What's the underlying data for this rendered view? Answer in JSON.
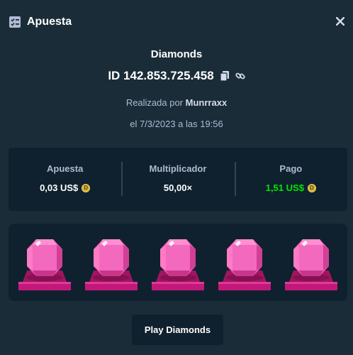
{
  "header": {
    "title": "Apuesta",
    "icon": "checklist-icon",
    "close_icon": "close-icon"
  },
  "bet": {
    "game": "Diamonds",
    "id": "ID 142.853.725.458",
    "placed_by_prefix": "Realizada por",
    "user": "Munrraxx",
    "date": "el 7/3/2023 a las 19:56"
  },
  "stats": [
    {
      "label": "Apuesta",
      "value": "0,03 US$",
      "coin": true,
      "color": "#ffffff"
    },
    {
      "label": "Multiplicador",
      "value": "50,00×",
      "coin": false,
      "color": "#ffffff"
    },
    {
      "label": "Pago",
      "value": "1,51 US$",
      "coin": true,
      "color": "#00e701"
    }
  ],
  "coin_symbol": "D",
  "board": {
    "gems": [
      "pink-gem",
      "pink-gem",
      "pink-gem",
      "pink-gem",
      "pink-gem"
    ]
  },
  "play_button": "Play Diamonds",
  "colors": {
    "background": "#1a2c38",
    "panel": "#0f212e",
    "gem": "#f05bb5",
    "gem_base": "#c2187a",
    "payout": "#00e701"
  }
}
